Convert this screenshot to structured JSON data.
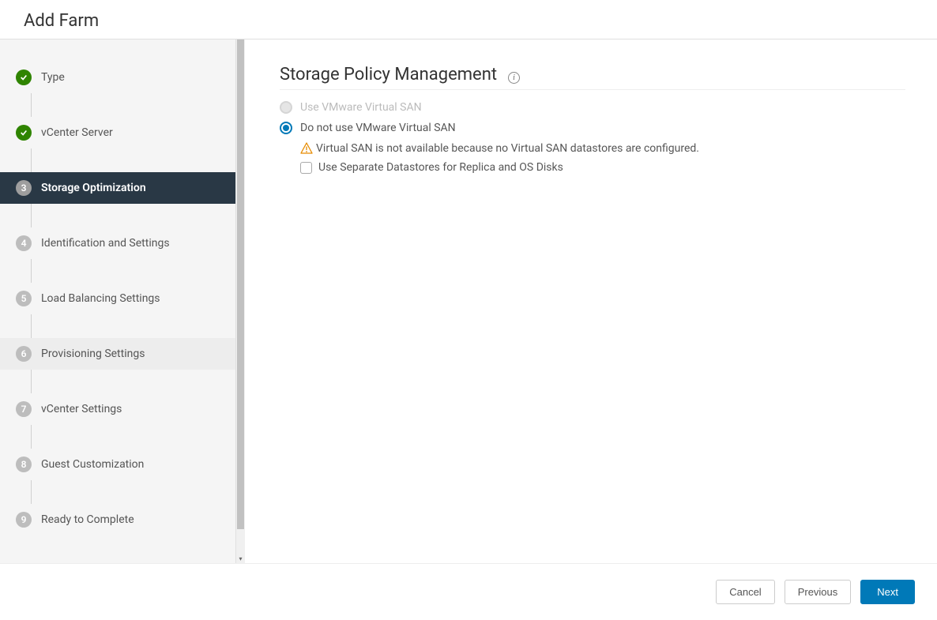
{
  "header": {
    "title": "Add Farm"
  },
  "sidebar": {
    "steps": [
      {
        "label": "Type",
        "state": "done"
      },
      {
        "label": "vCenter Server",
        "state": "done"
      },
      {
        "label": "Storage Optimization",
        "state": "active",
        "num": "3"
      },
      {
        "label": "Identification and Settings",
        "state": "pending",
        "num": "4"
      },
      {
        "label": "Load Balancing Settings",
        "state": "pending",
        "num": "5"
      },
      {
        "label": "Provisioning Settings",
        "state": "pending",
        "num": "6",
        "hover": true
      },
      {
        "label": "vCenter Settings",
        "state": "pending",
        "num": "7"
      },
      {
        "label": "Guest Customization",
        "state": "pending",
        "num": "8"
      },
      {
        "label": "Ready to Complete",
        "state": "pending",
        "num": "9"
      }
    ]
  },
  "main": {
    "section_title": "Storage Policy Management",
    "options": {
      "use_vsan_label": "Use VMware Virtual SAN",
      "do_not_use_vsan_label": "Do not use VMware Virtual SAN",
      "warning_text": "Virtual SAN is not available because no Virtual SAN datastores are configured.",
      "checkbox_label": "Use Separate Datastores for Replica and OS Disks"
    }
  },
  "footer": {
    "cancel": "Cancel",
    "previous": "Previous",
    "next": "Next"
  }
}
